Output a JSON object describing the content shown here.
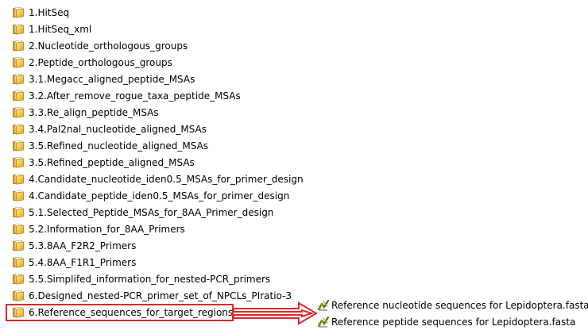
{
  "folders": [
    {
      "name": "1.HitSeq",
      "icon": "folder-icon"
    },
    {
      "name": "1.HitSeq_xml",
      "icon": "folder-icon"
    },
    {
      "name": "2.Nucleotide_orthologous_groups",
      "icon": "folder-icon"
    },
    {
      "name": "2.Peptide_orthologous_groups",
      "icon": "folder-icon"
    },
    {
      "name": "3.1.Megacc_aligned_peptide_MSAs",
      "icon": "folder-icon"
    },
    {
      "name": "3.2.After_remove_rogue_taxa_peptide_MSAs",
      "icon": "folder-icon"
    },
    {
      "name": "3.3.Re_align_peptide_MSAs",
      "icon": "folder-icon"
    },
    {
      "name": "3.4.Pal2nal_nucleotide_aligned_MSAs",
      "icon": "folder-icon"
    },
    {
      "name": "3.5.Refined_nucleotide_aligned_MSAs",
      "icon": "folder-icon"
    },
    {
      "name": "3.5.Refined_peptide_aligned_MSAs",
      "icon": "folder-icon"
    },
    {
      "name": "4.Candidate_nucleotide_iden0.5_MSAs_for_primer_design",
      "icon": "folder-icon"
    },
    {
      "name": "4.Candidate_peptide_iden0.5_MSAs_for_primer_design",
      "icon": "folder-icon"
    },
    {
      "name": "5.1.Selected_Peptide_MSAs_for_8AA_Primer_design",
      "icon": "folder-icon"
    },
    {
      "name": "5.2.Information_for_8AA_Primers",
      "icon": "folder-icon"
    },
    {
      "name": "5.3.8AA_F2R2_Primers",
      "icon": "folder-icon"
    },
    {
      "name": "5.4.8AA_F1R1_Primers",
      "icon": "folder-icon"
    },
    {
      "name": "5.5.Simplifed_information_for_nested-PCR_primers",
      "icon": "folder-icon"
    },
    {
      "name": "6.Designed_nested-PCR_primer_set_of_NPCLs_PIratio-3",
      "icon": "folder-icon"
    },
    {
      "name": "6.Reference_sequences_for_target_regions",
      "icon": "folder-icon",
      "highlighted": true
    }
  ],
  "files": [
    {
      "name": "Reference nucleotide sequences for Lepidoptera.fasta",
      "icon": "fasta-file-icon"
    },
    {
      "name": "Reference peptide sequences for Lepidoptera.fasta",
      "icon": "fasta-file-icon"
    }
  ],
  "colors": {
    "highlight": "#e0262c",
    "folder": "#f3c44a",
    "text": "#000000",
    "background": "#ffffff"
  }
}
